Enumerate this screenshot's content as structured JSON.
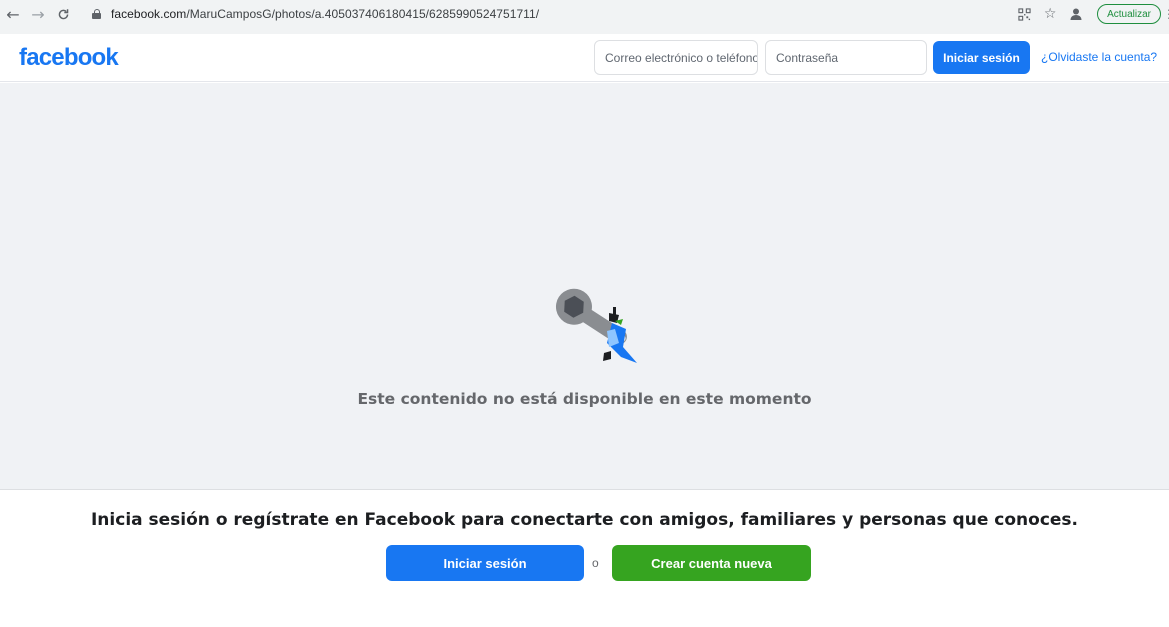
{
  "browser": {
    "url_domain": "facebook.com",
    "url_path": "/MaruCamposG/photos/a.405037406180415/6285990524751711/",
    "update_label": "Actualizar",
    "icons": [
      "back-icon",
      "forward-icon",
      "reload-icon",
      "lock-icon",
      "qr-code-icon",
      "star-icon",
      "profile-icon",
      "menu-icon"
    ]
  },
  "header": {
    "logo": "facebook",
    "email_placeholder": "Correo electrónico o teléfono",
    "password_placeholder": "Contraseña",
    "login_label": "Iniciar sesión",
    "forgot_label": "¿Olvidaste la cuenta?"
  },
  "main": {
    "message": "Este contenido no está disponible en este momento",
    "illustration_icon": "wrench-bird-icon"
  },
  "banner": {
    "text": "Inicia sesión o regístrate en Facebook para conectarte con amigos, familiares y personas que conoces.",
    "login_label": "Iniciar sesión",
    "or_label": "o",
    "create_label": "Crear cuenta nueva"
  },
  "colors": {
    "brand": "#1877f2",
    "create_green": "#36a420",
    "page_bg": "#f0f2f5"
  }
}
